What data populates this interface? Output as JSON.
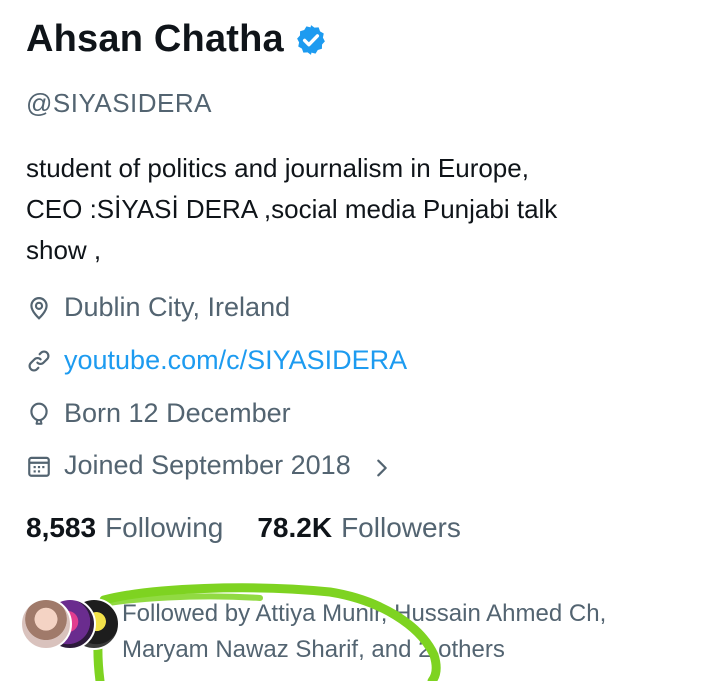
{
  "profile": {
    "name": "Ahsan Chatha",
    "handle": "@SIYASIDERA",
    "bio_lines": [
      "student of politics and journalism in Europe,",
      "CEO :SİYASİ DERA ,social media Punjabi talk",
      "show ,"
    ],
    "location": "Dublin City, Ireland",
    "website": "youtube.com/c/SIYASIDERA",
    "birthday": "Born 12 December",
    "joined": "Joined September 2018",
    "icons": {
      "verified": "verified-badge-icon",
      "location": "location-pin-icon",
      "website": "link-icon",
      "birthday": "balloon-icon",
      "joined": "calendar-icon",
      "chevron": "chevron-right-icon"
    },
    "colors": {
      "verified": "#1d9bf0",
      "link": "#1d9bf0",
      "secondary_text": "#536471",
      "annotation": "#7ed321"
    }
  },
  "stats": {
    "following_count": "8,583",
    "following_label": "Following",
    "followers_count": "78.2K",
    "followers_label": "Followers"
  },
  "followed_by": {
    "line1": "Followed by Attiya Munir, Hussain Ahmed Ch,",
    "line2": "Maryam Nawaz Sharif, and 2 others"
  }
}
